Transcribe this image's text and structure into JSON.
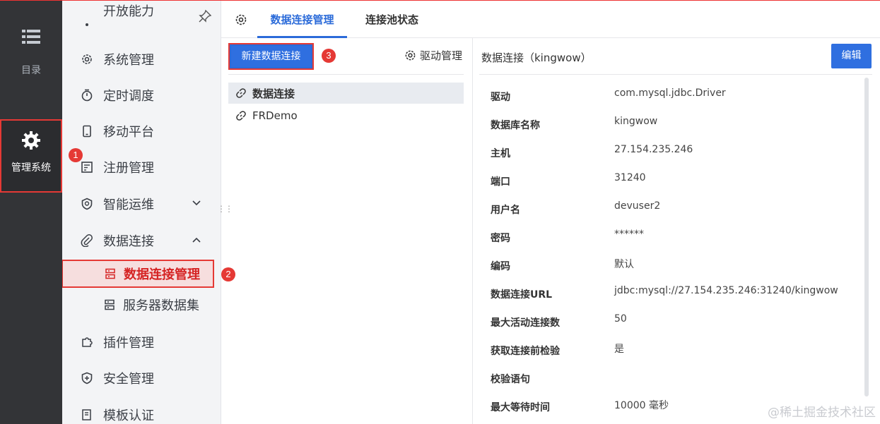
{
  "rail": {
    "directory_label": "目录",
    "system_label": "管理系统"
  },
  "menu": {
    "partial_top_label": "开放能力",
    "items": [
      {
        "label": "系统管理",
        "icon": "gear-icon"
      },
      {
        "label": "定时调度",
        "icon": "timer-icon"
      },
      {
        "label": "移动平台",
        "icon": "mobile-icon"
      },
      {
        "label": "注册管理",
        "icon": "register-icon"
      },
      {
        "label": "智能运维",
        "icon": "ops-icon",
        "arrow": "chevron-down-icon"
      },
      {
        "label": "数据连接",
        "icon": "paperclip-icon",
        "arrow": "chevron-up-icon"
      },
      {
        "label": "插件管理",
        "icon": "puzzle-icon"
      },
      {
        "label": "安全管理",
        "icon": "shield-icon"
      },
      {
        "label": "模板认证",
        "icon": "template-icon"
      }
    ],
    "subitems": [
      {
        "label": "数据连接管理",
        "active": true
      },
      {
        "label": "服务器数据集",
        "active": false
      }
    ]
  },
  "badges": [
    "1",
    "2",
    "3"
  ],
  "tabs": [
    {
      "label": "数据连接管理",
      "active": true
    },
    {
      "label": "连接池状态",
      "active": false
    }
  ],
  "list": {
    "new_button": "新建数据连接",
    "driver_button": "驱动管理",
    "connections": [
      {
        "label": "数据连接",
        "selected": true
      },
      {
        "label": "FRDemo",
        "selected": false
      }
    ]
  },
  "detail": {
    "title": "数据连接（kingwow）",
    "edit_button": "编辑",
    "rows": [
      {
        "key": "驱动",
        "value": "com.mysql.jdbc.Driver"
      },
      {
        "key": "数据库名称",
        "value": "kingwow"
      },
      {
        "key": "主机",
        "value": "27.154.235.246"
      },
      {
        "key": "端口",
        "value": "31240"
      },
      {
        "key": "用户名",
        "value": "devuser2"
      },
      {
        "key": "密码",
        "value": "******"
      },
      {
        "key": "编码",
        "value": "默认"
      },
      {
        "key": "数据连接URL",
        "value": "jdbc:mysql://27.154.235.246:31240/kingwow"
      },
      {
        "key": "最大活动连接数",
        "value": "50"
      },
      {
        "key": "获取连接前检验",
        "value": "是"
      },
      {
        "key": "校验语句",
        "value": ""
      },
      {
        "key": "最大等待时间",
        "value": "10000 毫秒"
      }
    ]
  },
  "watermark": "@稀土掘金技术社区",
  "colors": {
    "accent": "#2f6fe0",
    "highlight": "#e53935",
    "rail_bg": "#333437",
    "menu_bg": "#f3f4f6"
  }
}
